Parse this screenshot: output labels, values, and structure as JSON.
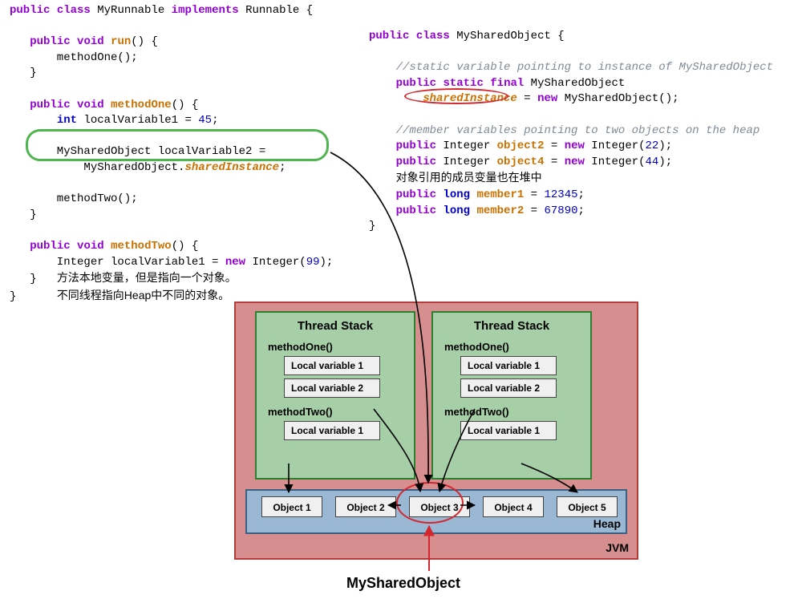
{
  "left": {
    "cls": "MyRunnable",
    "impl": "Runnable",
    "run": "run",
    "m1": "methodOne",
    "m1_var1_decl": "localVariable1",
    "m1_var1_val": "45",
    "m1_var2_decl": "localVariable2",
    "m1_var2_rhs_cls": "MySharedObject",
    "m1_var2_rhs_field": "sharedInstance",
    "m2": "methodTwo",
    "m2_var1_decl": "localVariable1",
    "m2_var1_val": "99",
    "note1": "方法本地变量，但是指向一个对象。",
    "note2": "不同线程指向Heap中不同的对象。"
  },
  "right": {
    "cls": "MySharedObject",
    "cmt1": "//static variable pointing to instance of MySharedObject",
    "static_name": "sharedInstance",
    "static_rhs": "MySharedObject()",
    "cmt2": "//member variables pointing to two objects on the heap",
    "obj2_name": "object2",
    "obj2_val": "22",
    "obj4_name": "object4",
    "obj4_val": "44",
    "extra": "对象引用的成员变量也在堆中",
    "mem1_name": "member1",
    "mem1_val": "12345",
    "mem2_name": "member2",
    "mem2_val": "67890"
  },
  "jvm": {
    "label": "JVM",
    "stack_title": "Thread Stack",
    "m1": "methodOne()",
    "m2": "methodTwo()",
    "lv1": "Local variable 1",
    "lv2": "Local variable 2",
    "heap_label": "Heap",
    "objs": [
      "Object 1",
      "Object 2",
      "Object 3",
      "Object 4",
      "Object 5"
    ],
    "shared_label": "MySharedObject"
  }
}
